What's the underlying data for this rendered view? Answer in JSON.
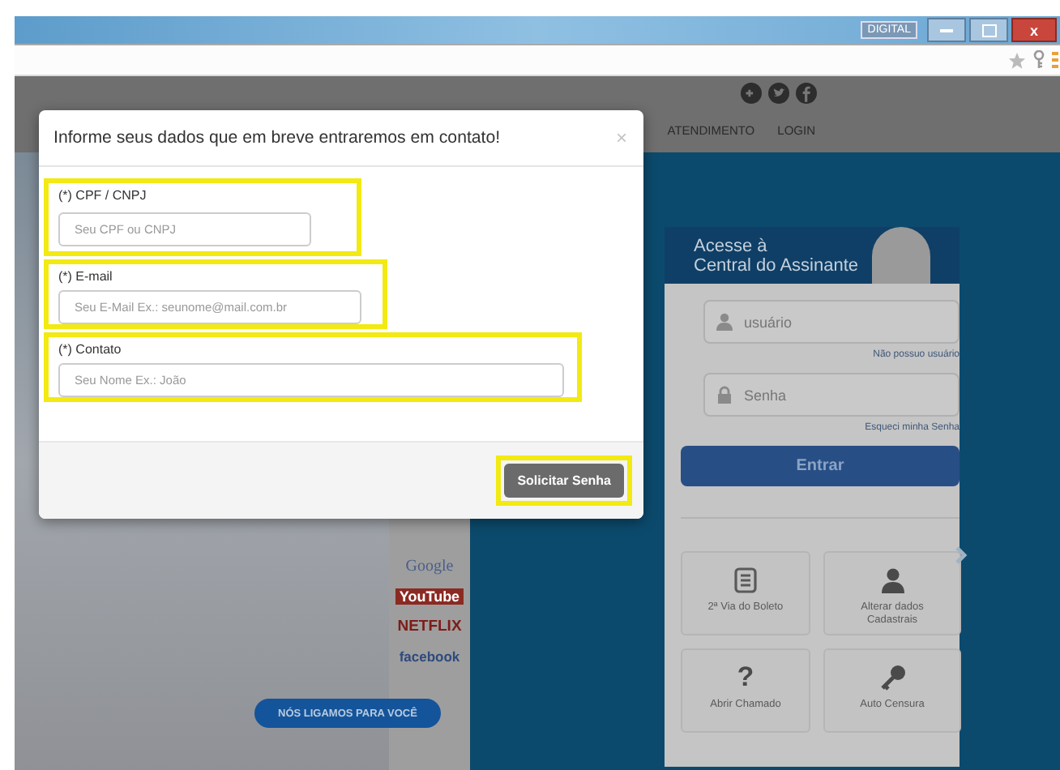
{
  "window": {
    "badge": "DIGITAL",
    "close": "x"
  },
  "site": {
    "nav": [
      "ATENDIMENTO",
      "LOGIN"
    ],
    "partners": [
      "Google",
      "YouTube",
      "NETFLIX",
      "facebook"
    ],
    "callout": "NÓS LIGAMOS PARA VOCÊ",
    "login": {
      "title": [
        "Acesse à",
        "Central do Assinante"
      ],
      "user_placeholder": "usuário",
      "user_link": "Não possuo usuário",
      "password_placeholder": "Senha",
      "password_link": "Esqueci minha Senha",
      "submit": "Entrar",
      "tiles": [
        {
          "kind": "invoice",
          "label": "2ª Via do Boleto"
        },
        {
          "kind": "profile",
          "label": "Alterar dados Cadastrais"
        },
        {
          "kind": "help",
          "icon": "?",
          "label": "Abrir Chamado"
        },
        {
          "kind": "key",
          "label": "Auto Censura"
        }
      ]
    }
  },
  "modal": {
    "title": "Informe seus dados que em breve entraremos em contato!",
    "close": "×",
    "fields": [
      {
        "label": "(*) CPF / CNPJ",
        "placeholder": "Seu CPF ou CNPJ",
        "highlighted": true
      },
      {
        "label": "(*) E-mail",
        "placeholder": "Seu E-Mail Ex.: seunome@mail.com.br",
        "highlighted": true
      },
      {
        "label": "(*) Contato",
        "placeholder": "Seu Nome Ex.: João",
        "highlighted": true
      }
    ],
    "button": {
      "label": "Solicitar Senha",
      "highlighted": true
    }
  }
}
